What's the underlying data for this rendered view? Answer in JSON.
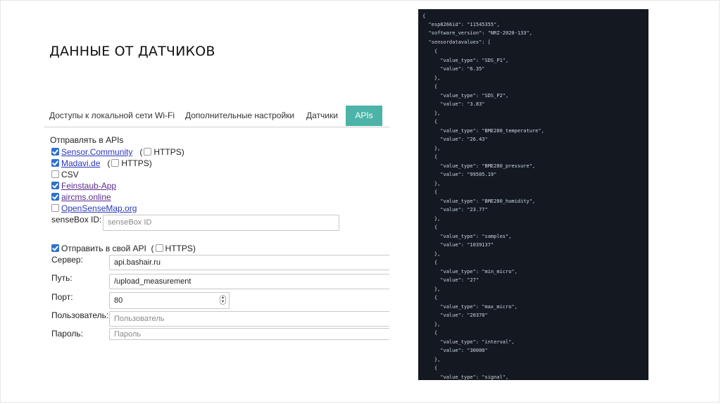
{
  "slide": {
    "title": "ДАННЫЕ ОТ ДАТЧИКОВ"
  },
  "tabs": [
    {
      "label": "Доступы к локальной сети Wi-Fi",
      "active": false
    },
    {
      "label": "Дополнительные настройки",
      "active": false
    },
    {
      "label": "Датчики",
      "active": false
    },
    {
      "label": "APIs",
      "active": true
    }
  ],
  "form": {
    "section_title": "Отправлять в APIs",
    "send_to": [
      {
        "label": "Sensor.Community",
        "checked": true,
        "https_label": "HTTPS",
        "https_checked": false
      },
      {
        "label": "Madavi.de",
        "checked": true,
        "https_label": "HTTPS",
        "https_checked": false
      },
      {
        "label": "CSV",
        "checked": false
      },
      {
        "label": "Feinstaub-App",
        "checked": true
      },
      {
        "label": "aircms.online",
        "checked": true
      },
      {
        "label": "OpenSenseMap.org",
        "checked": false
      }
    ],
    "sensebox": {
      "label": "senseBox ID:",
      "placeholder": "senseBox ID"
    },
    "custom_api": {
      "label": "Отправить в свой API",
      "checked": true,
      "https_label": "HTTPS",
      "https_checked": false,
      "server_label": "Сервер:",
      "server_value": "api.bashair.ru",
      "path_label": "Путь:",
      "path_value": "/upload_measurement",
      "port_label": "Порт:",
      "port_value": "80",
      "user_label": "Пользователь:",
      "user_placeholder": "Пользователь",
      "password_label": "Пароль:",
      "password_placeholder": "Пароль"
    }
  },
  "code_panel": {
    "lines": [
      "{",
      "  \"esp8266id\": \"11545355\",",
      "  \"software_version\": \"NRZ-2020-133\",",
      "  \"sensordatavalues\": [",
      "    {",
      "      \"value_type\": \"SDS_P1\",",
      "      \"value\": \"6.35\"",
      "    },",
      "    {",
      "      \"value_type\": \"SDS_P2\",",
      "      \"value\": \"3.83\"",
      "    },",
      "    {",
      "      \"value_type\": \"BME280_temperature\",",
      "      \"value\": \"26.43\"",
      "    },",
      "    {",
      "      \"value_type\": \"BME280_pressure\",",
      "      \"value\": \"99505.19\"",
      "    },",
      "    {",
      "      \"value_type\": \"BME280_humidity\",",
      "      \"value\": \"23.77\"",
      "    },",
      "    {",
      "      \"value_type\": \"samples\",",
      "      \"value\": \"1039137\"",
      "    },",
      "    {",
      "      \"value_type\": \"min_micro\",",
      "      \"value\": \"27\"",
      "    },",
      "    {",
      "      \"value_type\": \"max_micro\",",
      "      \"value\": \"20370\"",
      "    },",
      "    {",
      "      \"value_type\": \"interval\",",
      "      \"value\": \"30000\"",
      "    },",
      "    {",
      "      \"value_type\": \"signal\","
    ]
  }
}
